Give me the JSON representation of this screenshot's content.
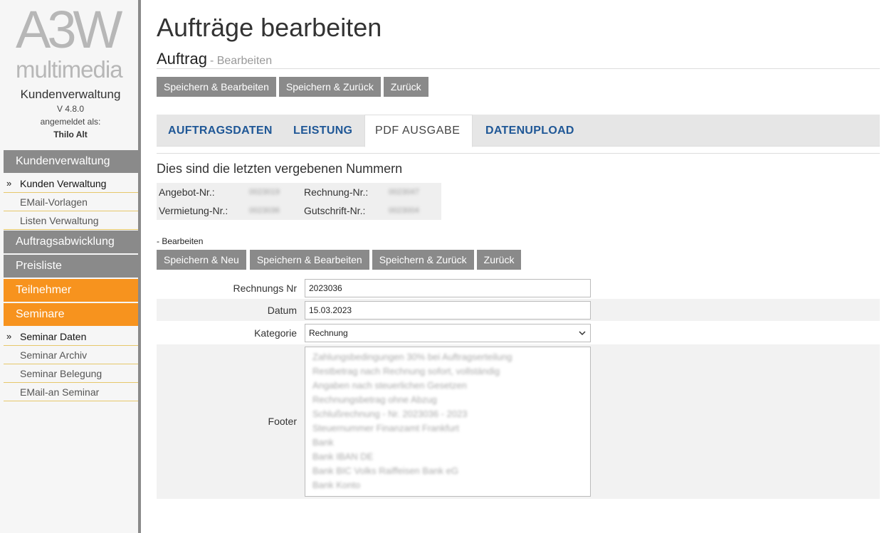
{
  "sidebar": {
    "logo_main": "A3W",
    "logo_sub": "multimedia",
    "app_name": "Kundenverwaltung",
    "version": "V 4.8.0",
    "logged_in_label": "angemeldet als:",
    "user": "Thilo Alt",
    "sections": [
      {
        "label": "Kundenverwaltung",
        "color": "#8a8a8a",
        "items": [
          {
            "label": "Kunden Verwaltung",
            "active": true
          },
          {
            "label": "EMail-Vorlagen",
            "active": false
          },
          {
            "label": "Listen Verwaltung",
            "active": false
          }
        ]
      },
      {
        "label": "Auftragsabwicklung",
        "color": "#8a8a8a",
        "items": []
      },
      {
        "label": "Preisliste",
        "color": "#8a8a8a",
        "items": []
      },
      {
        "label": "Teilnehmer",
        "color": "#f7931e",
        "items": []
      },
      {
        "label": "Seminare",
        "color": "#f7931e",
        "items": [
          {
            "label": "Seminar Daten",
            "active": true
          },
          {
            "label": "Seminar Archiv",
            "active": false
          },
          {
            "label": "Seminar Belegung",
            "active": false
          },
          {
            "label": "EMail-an Seminar",
            "active": false
          }
        ]
      }
    ],
    "active_arrow": "»"
  },
  "header": {
    "title": "Aufträge bearbeiten",
    "subtitle": "Auftrag",
    "subtitle_suffix": "- Bearbeiten"
  },
  "toolbar_top": {
    "save_edit": "Speichern & Bearbeiten",
    "save_back": "Speichern & Zurück",
    "back": "Zurück"
  },
  "tabs": [
    {
      "label": "AUFTRAGSDATEN",
      "active": false
    },
    {
      "label": "LEISTUNG",
      "active": false
    },
    {
      "label": "PDF AUSGABE",
      "active": true
    },
    {
      "label": "DATENUPLOAD",
      "active": false
    }
  ],
  "last_numbers": {
    "heading": "Dies sind die letzten vergebenen Nummern",
    "angebot_label": "Angebot-Nr.:",
    "angebot_value": "0023019",
    "rechnung_label": "Rechnung-Nr.:",
    "rechnung_value": "0023047",
    "vermietung_label": "Vermietung-Nr.:",
    "vermietung_value": "0023036",
    "gutschrift_label": "Gutschrift-Nr.:",
    "gutschrift_value": "0023004"
  },
  "form_section_label": "- Bearbeiten",
  "toolbar_form": {
    "save_new": "Speichern & Neu",
    "save_edit": "Speichern & Bearbeiten",
    "save_back": "Speichern & Zurück",
    "back": "Zurück"
  },
  "form": {
    "rechnungs_nr_label": "Rechnungs Nr",
    "rechnungs_nr_value": "2023036",
    "datum_label": "Datum",
    "datum_value": "15.03.2023",
    "kategorie_label": "Kategorie",
    "kategorie_value": "Rechnung",
    "footer_label": "Footer",
    "footer_lines": [
      "Zahlungsbedingungen 30% bei Auftragserteilung",
      "Restbetrag nach Rechnung sofort, vollständig",
      "Angaben nach steuerlichen Gesetzen",
      "Rechnungsbetrag ohne Abzug",
      "Schlußrechnung - Nr. 2023036 - 2023",
      "Steuernummer Finanzamt Frankfurt",
      "Bank",
      "Bank IBAN DE",
      "Bank BIC Volks Raiffeisen Bank eG",
      "Bank Konto"
    ]
  }
}
